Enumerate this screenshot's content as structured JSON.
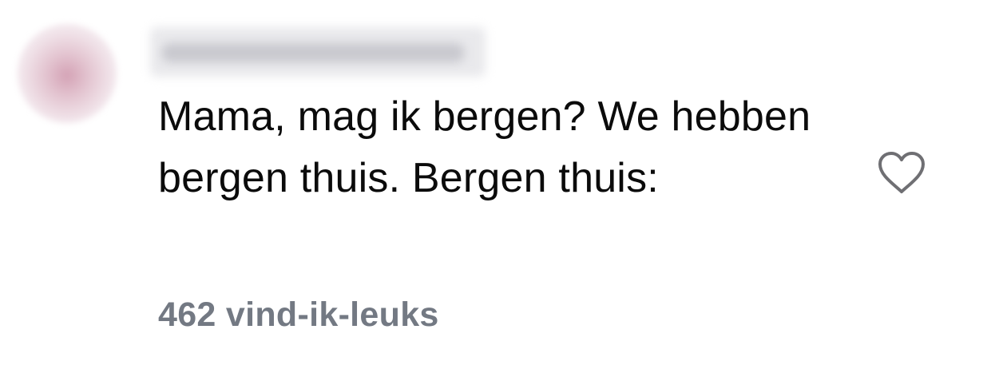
{
  "comment": {
    "text": "Mama, mag ik bergen? We hebben bergen thuis. Bergen thuis:",
    "likes_label": "462 vind-ik-leuks",
    "like_icon": "heart-outline-icon",
    "colors": {
      "text": "#0b0b0b",
      "meta": "#737983",
      "icon": "#6f6f73"
    }
  }
}
